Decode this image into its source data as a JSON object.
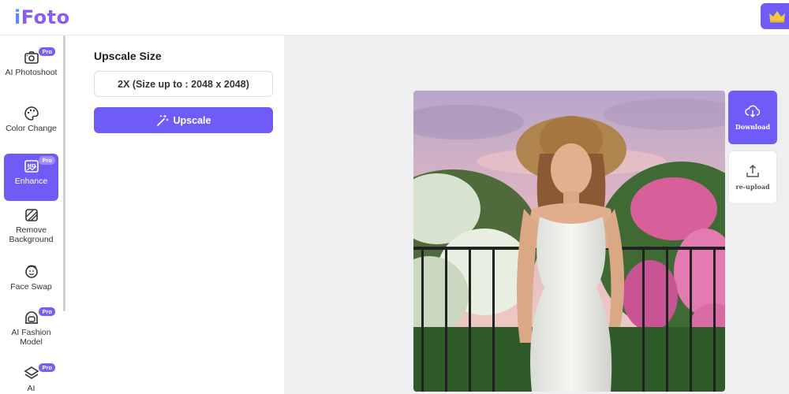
{
  "header": {
    "logo_text_part1": "i",
    "logo_text_part2": "Foto",
    "crown_icon": "crown-icon"
  },
  "nav": {
    "items": [
      {
        "label": "AI Photoshoot",
        "icon": "camera-icon",
        "pro": "Pro",
        "active": false
      },
      {
        "label": "Color Change",
        "icon": "palette-icon",
        "pro": "",
        "active": false
      },
      {
        "label": "Enhance",
        "icon": "hd-icon",
        "pro": "Pro",
        "active": true
      },
      {
        "label": "Remove Background",
        "icon": "erase-icon",
        "pro": "",
        "active": false
      },
      {
        "label": "Face Swap",
        "icon": "face-swap-icon",
        "pro": "",
        "active": false
      },
      {
        "label": "AI Fashion Model",
        "icon": "model-icon",
        "pro": "Pro",
        "active": false
      },
      {
        "label": "AI",
        "icon": "layers-icon",
        "pro": "Pro",
        "active": false
      }
    ]
  },
  "panel": {
    "title": "Upscale Size",
    "size_option": "2X (Size up to : 2048 x 2048)",
    "upscale_label": "Upscale"
  },
  "canvas": {
    "download_label": "Download",
    "reupload_label": "re-upload"
  },
  "colors": {
    "accent": "#6f5cf6",
    "canvas_bg": "#efeff2"
  }
}
